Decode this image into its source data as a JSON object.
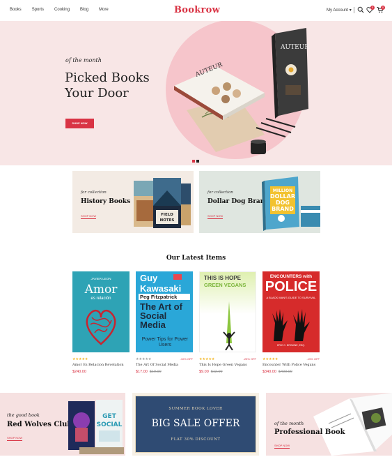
{
  "header": {
    "nav": [
      "Books",
      "Sports",
      "Cooking",
      "Blog",
      "More"
    ],
    "logo": "Bookrow",
    "account": "My Account",
    "wishlist_count": "0",
    "cart_count": "0"
  },
  "hero": {
    "subtitle": "of the month",
    "title_line1": "Picked Books",
    "title_line2": "Your Door",
    "button": "SHOP NOW",
    "book_text": "AUTEUR"
  },
  "collections": [
    {
      "subtitle": "for collection",
      "title": "History Books",
      "link": "SHOP NOW",
      "book_text": "FIELD NOTES"
    },
    {
      "subtitle": "for collection",
      "title": "Dollar Dog Brand",
      "link": "SHOP NOW",
      "book_text": "MILLION DOLLAR DOG BRAND"
    }
  ],
  "latest": {
    "title": "Our Latest Items",
    "items": [
      {
        "name": "Amor Es Relacion Revelation",
        "price": "$240.00",
        "old_price": "",
        "discount": "",
        "cover_author": "JAVIER LEON",
        "cover_title": "Amor",
        "cover_sub": "es relación"
      },
      {
        "name": "The Art Of Social Media",
        "price": "$17.00",
        "old_price": "$19.00",
        "discount": "-10% OFF",
        "cover_author": "Guy Kawasaki",
        "cover_author2": "Peg Fitzpatrick",
        "cover_title": "The Art of Social Media",
        "cover_sub": "Power Tips for Power Users"
      },
      {
        "name": "This Is Hope Green Vegans",
        "price": "$9.00",
        "old_price": "$12.00",
        "discount": "-25% OFF",
        "cover_title": "THIS IS HOPE",
        "cover_sub": "GREEN VEGANS"
      },
      {
        "name": "Encounter With Police Vegans",
        "price": "$340.00",
        "old_price": "$400.00",
        "discount": "-15% OFF",
        "cover_title": "POLICE",
        "cover_top": "ENCOUNTERS with",
        "cover_sub": "A BLACK MAN'S GUIDE TO SURVIVAL"
      }
    ]
  },
  "bottom_banners": [
    {
      "subtitle": "the good book",
      "title": "Red Wolves Club",
      "link": "SHOP NOW"
    },
    {
      "top": "SUMMER BOOK LOVER",
      "title": "BIG SALE OFFER",
      "bottom": "FLAT 30% DISCOUNT"
    },
    {
      "subtitle": "of the month",
      "title": "Professional Book",
      "link": "SHOP NOW"
    }
  ],
  "colors": {
    "accent": "#d93344",
    "hero_bg": "#f8e6e6",
    "sale_bg": "#2f4b73"
  }
}
